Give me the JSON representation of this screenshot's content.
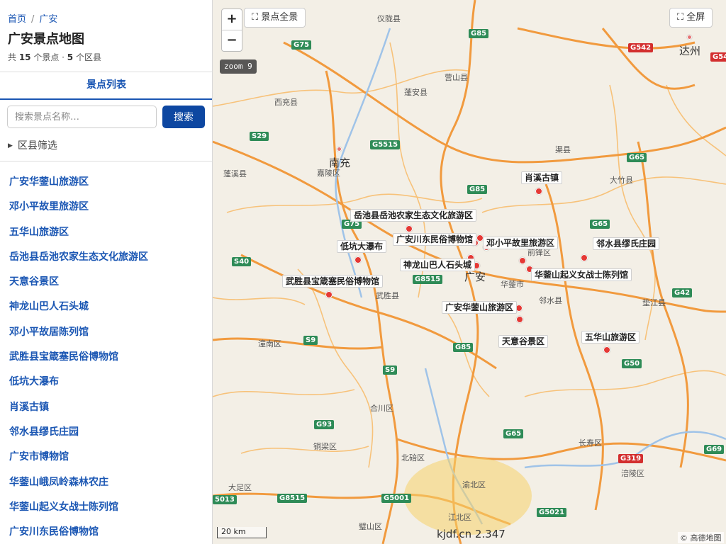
{
  "breadcrumb": {
    "home": "首页",
    "separator": "/",
    "current": "广安"
  },
  "page_title": "广安景点地图",
  "stats": {
    "prefix": "共 ",
    "spots": "15",
    "spots_unit": " 个景点 · ",
    "districts": "5",
    "districts_unit": " 个区县"
  },
  "tab_label": "景点列表",
  "search": {
    "placeholder": "搜索景点名称…",
    "button": "搜索"
  },
  "filter_label": "区县筛选",
  "spots": [
    "广安华蓥山旅游区",
    "邓小平故里旅游区",
    "五华山旅游区",
    "岳池县岳池农家生态文化旅游区",
    "天意谷景区",
    "神龙山巴人石头城",
    "邓小平故居陈列馆",
    "武胜县宝箴塞民俗博物馆",
    "低坑大瀑布",
    "肖溪古镇",
    "邻水县缪氏庄园",
    "广安市博物馆",
    "华蓥山峨凤岭森林农庄",
    "华蓥山起义女战士陈列馆",
    "广安川东民俗博物馆"
  ],
  "map": {
    "zoom_in": "+",
    "zoom_out": "−",
    "fit_label": "景点全景",
    "fullscreen_label": "全屏",
    "zoom_level": "zoom 9",
    "scale": "20 km",
    "watermark": "kjdf.cn 2.347",
    "copyright": "© 高德地图",
    "colors": {
      "road": "#f5a44a",
      "major_road": "#f08a2c",
      "river": "#9fc3e8",
      "marker": "#e53935",
      "accent": "#1a56b3"
    },
    "marker_labels": [
      "肖溪古镇",
      "岳池县岳池农家生态文化旅游区",
      "广安川东民俗博物馆",
      "邓小平故里旅游区",
      "邻水县缪氏庄园",
      "低坑大瀑布",
      "神龙山巴人石头城",
      "华蓥山起义女战士陈列馆",
      "武胜县宝箴塞民俗博物馆",
      "广安华蓥山旅游区",
      "天意谷景区",
      "五华山旅游区"
    ],
    "places": [
      "仪陇县",
      "营山县",
      "蓬安县",
      "西充县",
      "南充",
      "嘉陵区",
      "蓬溪县",
      "渠县",
      "大竹县",
      "达州",
      "前锋区",
      "广安",
      "华蓥市",
      "邻水县",
      "垫江县",
      "武胜县",
      "潼南区",
      "合川区",
      "铜梁区",
      "北碚区",
      "渝北区",
      "长寿区",
      "涪陵区",
      "大足区",
      "璧山区",
      "江北区"
    ],
    "highways": [
      "G85",
      "G75",
      "G542",
      "G54",
      "S29",
      "G5515",
      "G65",
      "G85",
      "G75",
      "S40",
      "G8515",
      "S9",
      "G65",
      "G42",
      "G85",
      "S9",
      "G50",
      "G93",
      "G65",
      "G319",
      "G69",
      "G8515",
      "G5001",
      "G5021",
      "5013"
    ]
  }
}
